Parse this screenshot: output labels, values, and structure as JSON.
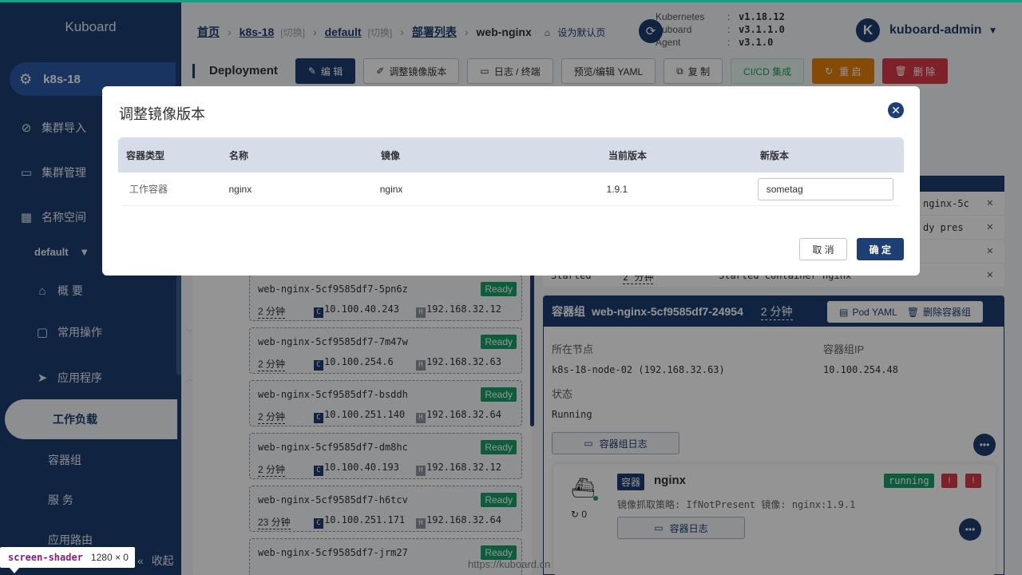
{
  "app": {
    "brand": "Kuboard"
  },
  "sidebar": {
    "cluster": "k8s-18",
    "items": [
      {
        "label": "集群导入"
      },
      {
        "label": "集群管理"
      },
      {
        "label": "名称空间"
      }
    ],
    "namespace": "default",
    "nav": [
      {
        "label": "概 要"
      },
      {
        "label": "常用操作"
      },
      {
        "label": "应用程序"
      }
    ],
    "active": "工作负载",
    "subs": [
      {
        "label": "容器组"
      },
      {
        "label": "服 务"
      },
      {
        "label": "应用路由"
      }
    ],
    "collapse": "收起"
  },
  "header": {
    "crumbs": {
      "home": "首页",
      "cluster": "k8s-18",
      "switch1": "[切换]",
      "ns": "default",
      "switch2": "[切换]",
      "list": "部署列表",
      "current": "web-nginx"
    },
    "set_default": "设为默认页",
    "versions": [
      {
        "key": "Kubernetes",
        "value": "v1.18.12"
      },
      {
        "key": "Kuboard",
        "value": "v3.1.1.0"
      },
      {
        "key": "Agent",
        "value": "v3.1.0"
      }
    ],
    "user": {
      "initial": "K",
      "name": "kuboard-admin"
    }
  },
  "toolbar": {
    "title": "Deployment",
    "buttons": {
      "edit": "编 辑",
      "adjust_image": "调整镜像版本",
      "logs": "日志 / 终端",
      "yaml": "预览/编辑 YAML",
      "copy": "复 制",
      "cicd": "CI/CD 集成",
      "restart": "重 启",
      "delete": "删 除"
    }
  },
  "events": [
    {
      "text": "nginx-5c"
    },
    {
      "text": "dy pres"
    },
    {
      "text": ""
    },
    {
      "status": "Started",
      "age": "2 分钟",
      "message": "Started container nginx"
    }
  ],
  "pods": [
    {
      "name": "web-nginx-5cf9585df7-5pn6z",
      "status": "Ready",
      "age": "2 分钟",
      "cip": "10.100.40.243",
      "hip": "192.168.32.12"
    },
    {
      "name": "web-nginx-5cf9585df7-7m47w",
      "status": "Ready",
      "age": "2 分钟",
      "cip": "10.100.254.6",
      "hip": "192.168.32.63"
    },
    {
      "name": "web-nginx-5cf9585df7-bsddh",
      "status": "Ready",
      "age": "2 分钟",
      "cip": "10.100.251.140",
      "hip": "192.168.32.64"
    },
    {
      "name": "web-nginx-5cf9585df7-dm8hc",
      "status": "Ready",
      "age": "2 分钟",
      "cip": "10.100.40.193",
      "hip": "192.168.32.12"
    },
    {
      "name": "web-nginx-5cf9585df7-h6tcv",
      "status": "Ready",
      "age": "23 分钟",
      "cip": "10.100.251.171",
      "hip": "192.168.32.64"
    },
    {
      "name": "web-nginx-5cf9585df7-jrm27",
      "status": "Ready"
    }
  ],
  "pod_detail": {
    "label": "容器组",
    "name": "web-nginx-5cf9585df7-24954",
    "age": "2 分钟",
    "pod_yaml": "Pod YAML",
    "delete": "删除容器组",
    "node_label": "所在节点",
    "node_value": "k8s-18-node-02 (192.168.32.63)",
    "ip_label": "容器组IP",
    "ip_value": "10.100.254.48",
    "status_label": "状态",
    "status_value": "Running",
    "log_button": "容器组日志",
    "container": {
      "badge": "容器",
      "name": "nginx",
      "state": "running",
      "restarts": "0",
      "policy": "镜像抓取策略: IfNotPresent 镜像: nginx:1.9.1",
      "log_button": "容器日志"
    }
  },
  "modal": {
    "title": "调整镜像版本",
    "columns": [
      "容器类型",
      "名称",
      "镜像",
      "当前版本",
      "新版本"
    ],
    "rows": [
      {
        "type": "工作容器",
        "name": "nginx",
        "image": "nginx",
        "current": "1.9.1",
        "new_value": "sometag"
      }
    ],
    "cancel": "取 消",
    "confirm": "确 定"
  },
  "footer": {
    "url": "https://kuboard.cn"
  },
  "shader": {
    "name": "screen-shader",
    "size": "1280 × 0"
  }
}
